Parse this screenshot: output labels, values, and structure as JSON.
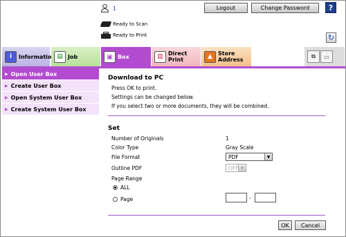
{
  "header": {
    "user_number": "1",
    "logout_label": "Logout",
    "change_password_label": "Change Password",
    "help_label": "?",
    "status_scan": "Ready to Scan",
    "status_print": "Ready to Print",
    "refresh_label": "↻"
  },
  "tabs": [
    {
      "label": "Information",
      "icon": "info-icon"
    },
    {
      "label": "Job",
      "icon": "job-icon"
    },
    {
      "label": "Box",
      "icon": "box-icon",
      "active": true
    },
    {
      "label": "Direct Print",
      "icon": "direct-print-icon"
    },
    {
      "label": "Store Address",
      "icon": "store-address-icon"
    }
  ],
  "sidebar": {
    "items": [
      {
        "label": "Open User Box",
        "active": true
      },
      {
        "label": "Create User Box"
      },
      {
        "label": "Open System User Box"
      },
      {
        "label": "Create System User Box"
      }
    ]
  },
  "download": {
    "title": "Download to PC",
    "line1": "Press OK to print.",
    "line2": "Settings can be changed below.",
    "line3": "If you select two or more documents, they will be combined."
  },
  "settings": {
    "title": "Set",
    "num_originals_label": "Number of Originals",
    "num_originals_value": "1",
    "color_type_label": "Color Type",
    "color_type_value": "Gray Scale",
    "file_format_label": "File Format",
    "file_format_value": "PDF",
    "outline_pdf_label": "Outline PDF",
    "outline_pdf_value": "OFF",
    "page_range_label": "Page Range",
    "page_range_all": "ALL",
    "page_range_page": "Page",
    "range_dash": "-"
  },
  "footer": {
    "ok_label": "OK",
    "cancel_label": "Cancel"
  },
  "colors": {
    "accent": "#b24bd0",
    "sidebar_bg": "#f3e2f9"
  }
}
